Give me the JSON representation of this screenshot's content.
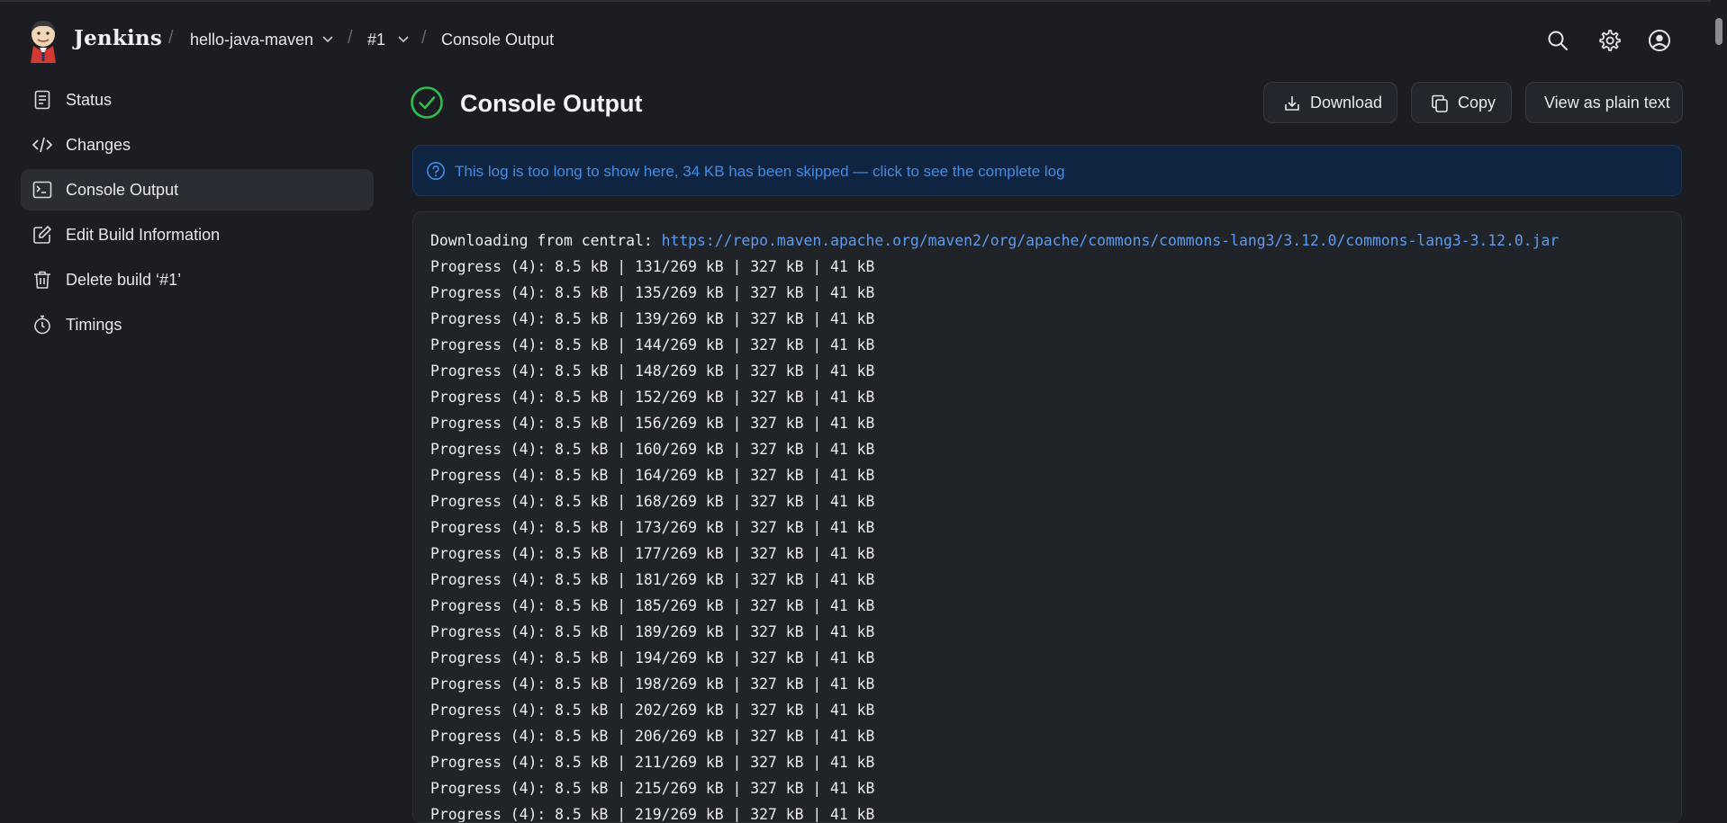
{
  "header": {
    "brand": "Jenkins",
    "breadcrumbs": [
      {
        "label": "hello-java-maven",
        "has_dropdown": true
      },
      {
        "label": "#1",
        "has_dropdown": true
      },
      {
        "label": "Console Output",
        "has_dropdown": false
      }
    ],
    "icons": [
      "search-icon",
      "gear-icon",
      "user-icon"
    ]
  },
  "sidebar": {
    "items": [
      {
        "label": "Status",
        "icon": "document-icon",
        "active": false
      },
      {
        "label": "Changes",
        "icon": "code-icon",
        "active": false
      },
      {
        "label": "Console Output",
        "icon": "terminal-icon",
        "active": true
      },
      {
        "label": "Edit Build Information",
        "icon": "edit-icon",
        "active": false
      },
      {
        "label": "Delete build ‘#1’",
        "icon": "trash-icon",
        "active": false
      },
      {
        "label": "Timings",
        "icon": "stopwatch-icon",
        "active": false
      }
    ]
  },
  "main": {
    "title": "Console Output",
    "status": "success",
    "buttons": {
      "download": "Download",
      "copy": "Copy",
      "plain_text": "View as plain text"
    },
    "notice": "This log is too long to show here, 34 KB has been skipped — click to see the complete log",
    "console": {
      "first_line_prefix": "Downloading from central: ",
      "first_line_url": "https://repo.maven.apache.org/maven2/org/apache/commons/commons-lang3/3.12.0/commons-lang3-3.12.0.jar",
      "lines": [
        "Progress (4): 8.5 kB | 131/269 kB | 327 kB | 41 kB",
        "Progress (4): 8.5 kB | 135/269 kB | 327 kB | 41 kB",
        "Progress (4): 8.5 kB | 139/269 kB | 327 kB | 41 kB",
        "Progress (4): 8.5 kB | 144/269 kB | 327 kB | 41 kB",
        "Progress (4): 8.5 kB | 148/269 kB | 327 kB | 41 kB",
        "Progress (4): 8.5 kB | 152/269 kB | 327 kB | 41 kB",
        "Progress (4): 8.5 kB | 156/269 kB | 327 kB | 41 kB",
        "Progress (4): 8.5 kB | 160/269 kB | 327 kB | 41 kB",
        "Progress (4): 8.5 kB | 164/269 kB | 327 kB | 41 kB",
        "Progress (4): 8.5 kB | 168/269 kB | 327 kB | 41 kB",
        "Progress (4): 8.5 kB | 173/269 kB | 327 kB | 41 kB",
        "Progress (4): 8.5 kB | 177/269 kB | 327 kB | 41 kB",
        "Progress (4): 8.5 kB | 181/269 kB | 327 kB | 41 kB",
        "Progress (4): 8.5 kB | 185/269 kB | 327 kB | 41 kB",
        "Progress (4): 8.5 kB | 189/269 kB | 327 kB | 41 kB",
        "Progress (4): 8.5 kB | 194/269 kB | 327 kB | 41 kB",
        "Progress (4): 8.5 kB | 198/269 kB | 327 kB | 41 kB",
        "Progress (4): 8.5 kB | 202/269 kB | 327 kB | 41 kB",
        "Progress (4): 8.5 kB | 206/269 kB | 327 kB | 41 kB",
        "Progress (4): 8.5 kB | 211/269 kB | 327 kB | 41 kB",
        "Progress (4): 8.5 kB | 215/269 kB | 327 kB | 41 kB",
        "Progress (4): 8.5 kB | 219/269 kB | 327 kB | 41 kB"
      ]
    }
  },
  "colors": {
    "background": "#1b1d22",
    "success": "#2fbf4e",
    "link": "#5c9cf0",
    "notice_bg": "#0f2440"
  }
}
